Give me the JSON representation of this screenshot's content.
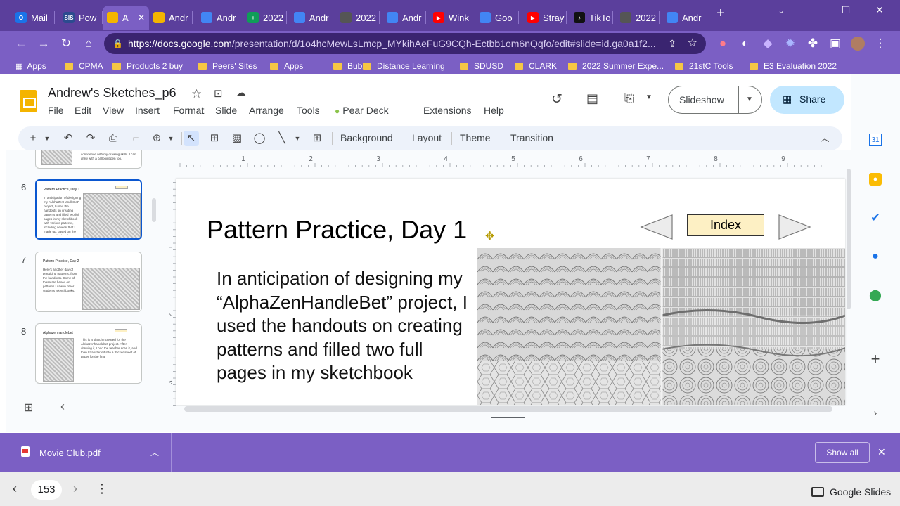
{
  "browser": {
    "tabs": [
      {
        "label": "Mail",
        "color": "#1a73e8",
        "fav": "O"
      },
      {
        "label": "Pow",
        "color": "#2c4b8f",
        "fav": "SIS"
      },
      {
        "label": "A",
        "color": "#f4b400",
        "fav": "",
        "active": true
      },
      {
        "label": "Andr",
        "color": "#f4b400",
        "fav": ""
      },
      {
        "label": "Andr",
        "color": "#4285f4",
        "fav": ""
      },
      {
        "label": "2022",
        "color": "#0f9d58",
        "fav": "+"
      },
      {
        "label": "Andr",
        "color": "#4285f4",
        "fav": ""
      },
      {
        "label": "2022",
        "color": "#555555",
        "fav": ""
      },
      {
        "label": "Andr",
        "color": "#4285f4",
        "fav": ""
      },
      {
        "label": "Wink",
        "color": "#ff0000",
        "fav": "▶"
      },
      {
        "label": "Goo",
        "color": "#4285f4",
        "fav": ""
      },
      {
        "label": "Stray",
        "color": "#ff0000",
        "fav": "▶"
      },
      {
        "label": "TikTo",
        "color": "#111111",
        "fav": "♪"
      },
      {
        "label": "2022",
        "color": "#555555",
        "fav": ""
      },
      {
        "label": "Andr",
        "color": "#4285f4",
        "fav": ""
      }
    ],
    "url_host": "https://docs.google.com",
    "url_rest": "/presentation/d/1o4hcMewLsLmcp_MYkihAeFuG9CQh-Ectbb1om6nQqfo/edit#slide=id.ga0a1f2...",
    "bookmarks": [
      "Apps",
      "CPMA",
      "Products 2 buy",
      "Peers' Sites",
      "Apps",
      "Bubz'",
      "Distance Learning",
      "SDUSD",
      "CLARK",
      "2022 Summer Expe...",
      "21stC Tools",
      "E3 Evaluation 2022"
    ]
  },
  "doc": {
    "title": "Andrew's Sketches_p6",
    "menus": [
      "File",
      "Edit",
      "View",
      "Insert",
      "Format",
      "Slide",
      "Arrange",
      "Tools",
      "Pear Deck",
      "Extensions",
      "Help"
    ],
    "slideshow_label": "Slideshow",
    "share_label": "Share"
  },
  "toolbar": {
    "background": "Background",
    "layout": "Layout",
    "theme": "Theme",
    "transition": "Transition"
  },
  "filmstrip": {
    "partial_text": "confidence with my drawing skills. I can draw with a ballpoint pen too.",
    "slides": [
      {
        "num": "6",
        "title": "Pattern Practice, Day 1",
        "text": "In anticipation of designing my “AlphaZenHandleBet” project, I used the handouts on creating patterns and filled two full pages in my sketchbook with various patterns, including several that I made up, based on the ones on the handouts."
      },
      {
        "num": "7",
        "title": "Pattern Practice, Day 2",
        "text": "Here's another day of practicing patterns, from the handouts. Some of these are based on patterns I saw in other students' sketchbooks."
      },
      {
        "num": "8",
        "title": "Alphazenhandlebet",
        "text": "This is a sketch I created for the Alphazenhandlebet project. After drawing it, I had the teacher scan it, and then I transferred it to a thicker sheet of paper for the final"
      }
    ]
  },
  "ruler": {
    "h": [
      "1",
      "2",
      "3",
      "4",
      "5",
      "6",
      "7",
      "8",
      "9"
    ],
    "v": [
      "1",
      "2",
      "3"
    ]
  },
  "slide": {
    "title": "Pattern Practice, Day 1",
    "body": "In anticipation of designing my “AlphaZenHandleBet” project, I used the handouts on creating patterns and filled two full pages in my sketchbook",
    "index_label": "Index"
  },
  "download": {
    "filename": "Movie Club.pdf",
    "show_all": "Show all"
  },
  "video": {
    "page": "153",
    "app_label": "Google Slides"
  }
}
